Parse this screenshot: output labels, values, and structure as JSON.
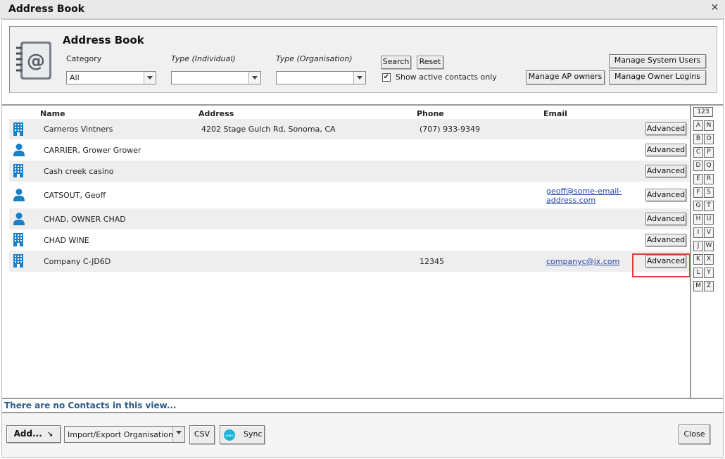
{
  "window": {
    "title": "Address Book",
    "close_glyph": "✕"
  },
  "header": {
    "title": "Address Book",
    "category_label": "Category",
    "category_value": "All",
    "type_individual_label": "Type (Individual)",
    "type_individual_value": "",
    "type_organisation_label": "Type (Organisation)",
    "type_organisation_value": "",
    "search_label": "Search",
    "reset_label": "Reset",
    "active_only_label": "Show active contacts only",
    "active_only_checked": "✔",
    "manage_system_users_label": "Manage System Users",
    "manage_ap_owners_label": "Manage AP owners",
    "manage_owner_logins_label": "Manage Owner Logins"
  },
  "columns": {
    "name": "Name",
    "address": "Address",
    "phone": "Phone",
    "email": "Email"
  },
  "rows": [
    {
      "type": "organisation",
      "name": "Carneros Vintners",
      "address": "4202 Stage Gulch Rd, Sonoma, CA",
      "phone": "(707) 933-9349",
      "email_line1": "",
      "email_line2": "",
      "action": "Advanced"
    },
    {
      "type": "individual",
      "name": "CARRIER, Grower Grower",
      "address": "",
      "phone": "",
      "email_line1": "",
      "email_line2": "",
      "action": "Advanced"
    },
    {
      "type": "organisation",
      "name": "Cash creek casino",
      "address": "",
      "phone": "",
      "email_line1": "",
      "email_line2": "",
      "action": "Advanced"
    },
    {
      "type": "individual",
      "name": "CATSOUT, Geoff",
      "address": "",
      "phone": "",
      "email_line1": "geoff@some-email-",
      "email_line2": "address.com",
      "action": "Advanced"
    },
    {
      "type": "individual",
      "name": "CHAD, OWNER CHAD",
      "address": "",
      "phone": "",
      "email_line1": "",
      "email_line2": "",
      "action": "Advanced"
    },
    {
      "type": "organisation",
      "name": "CHAD WINE",
      "address": "",
      "phone": "",
      "email_line1": "",
      "email_line2": "",
      "action": "Advanced"
    },
    {
      "type": "organisation",
      "name": "Company C-JD6D",
      "address": "",
      "phone": "12345",
      "email_line1": "companyc@jx.com",
      "email_line2": "",
      "action": "Advanced"
    }
  ],
  "alpha_index": {
    "all_label": "123",
    "left": [
      "A",
      "B",
      "C",
      "D",
      "E",
      "F",
      "G",
      "H",
      "I",
      "J",
      "K",
      "L",
      "M"
    ],
    "right": [
      "N",
      "O",
      "P",
      "Q",
      "R",
      "S",
      "T",
      "U",
      "V",
      "W",
      "X",
      "Y",
      "Z"
    ]
  },
  "status": {
    "no_contacts": "There are no Contacts in this view..."
  },
  "footer": {
    "add_label": "Add...",
    "import_export_value": "Import/Export Organisation",
    "csv_label": "CSV",
    "sync_label": "Sync",
    "sync_logo_text": "xero",
    "close_label": "Close"
  },
  "colors": {
    "accent_blue": "#1a7fc7",
    "link_blue": "#2244aa",
    "status_blue": "#2a5b8c",
    "highlight_red": "#e03b3b"
  }
}
